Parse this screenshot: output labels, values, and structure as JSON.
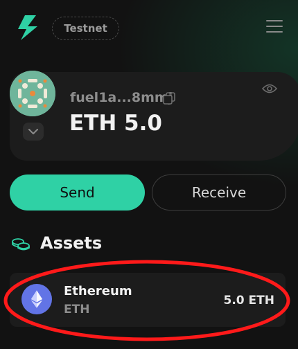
{
  "header": {
    "network_label": "Testnet",
    "logo_icon": "fuel-logo-icon",
    "menu_icon": "hamburger-menu-icon"
  },
  "account": {
    "address": "fuel1a...8mmj",
    "balance": "ETH 5.0",
    "copy_icon": "copy-icon",
    "visibility_icon": "eye-icon",
    "switcher_icon": "chevron-down-icon"
  },
  "actions": {
    "send_label": "Send",
    "receive_label": "Receive"
  },
  "assets": {
    "title": "Assets",
    "icon": "coins-icon",
    "items": [
      {
        "name": "Ethereum",
        "symbol": "ETH",
        "amount": "5.0 ETH",
        "icon": "ethereum-icon"
      }
    ]
  },
  "colors": {
    "accent": "#2fd1a5",
    "background": "#121212",
    "card": "#1c1c1c",
    "annotation": "#ff1a1a",
    "eth_icon_bg": "#6274e6"
  }
}
